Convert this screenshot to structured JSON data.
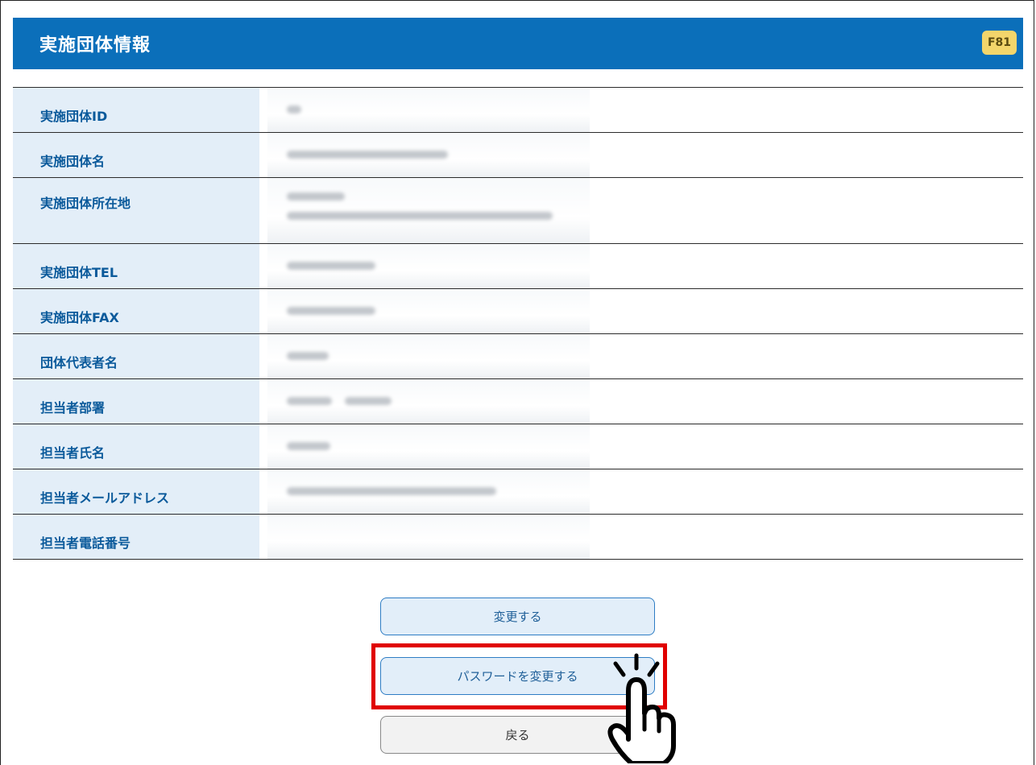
{
  "header": {
    "title": "実施団体情報",
    "screen_id": "F81"
  },
  "rows": [
    {
      "label": "実施団体ID"
    },
    {
      "label": "実施団体名"
    },
    {
      "label": "実施団体所在地"
    },
    {
      "label": "実施団体TEL"
    },
    {
      "label": "実施団体FAX"
    },
    {
      "label": "団体代表者名"
    },
    {
      "label": "担当者部署"
    },
    {
      "label": "担当者氏名"
    },
    {
      "label": "担当者メールアドレス"
    },
    {
      "label": "担当者電話番号"
    }
  ],
  "buttons": {
    "change": "変更する",
    "change_password": "パスワードを変更する",
    "back": "戻る"
  },
  "colors": {
    "header_bg": "#0b6fba",
    "label_bg": "#e3eef8",
    "label_text": "#0b5a9b",
    "highlight": "#e00000",
    "badge_bg": "#f3d56b"
  },
  "icons": {
    "pointer": "pointing-hand-click-icon"
  }
}
